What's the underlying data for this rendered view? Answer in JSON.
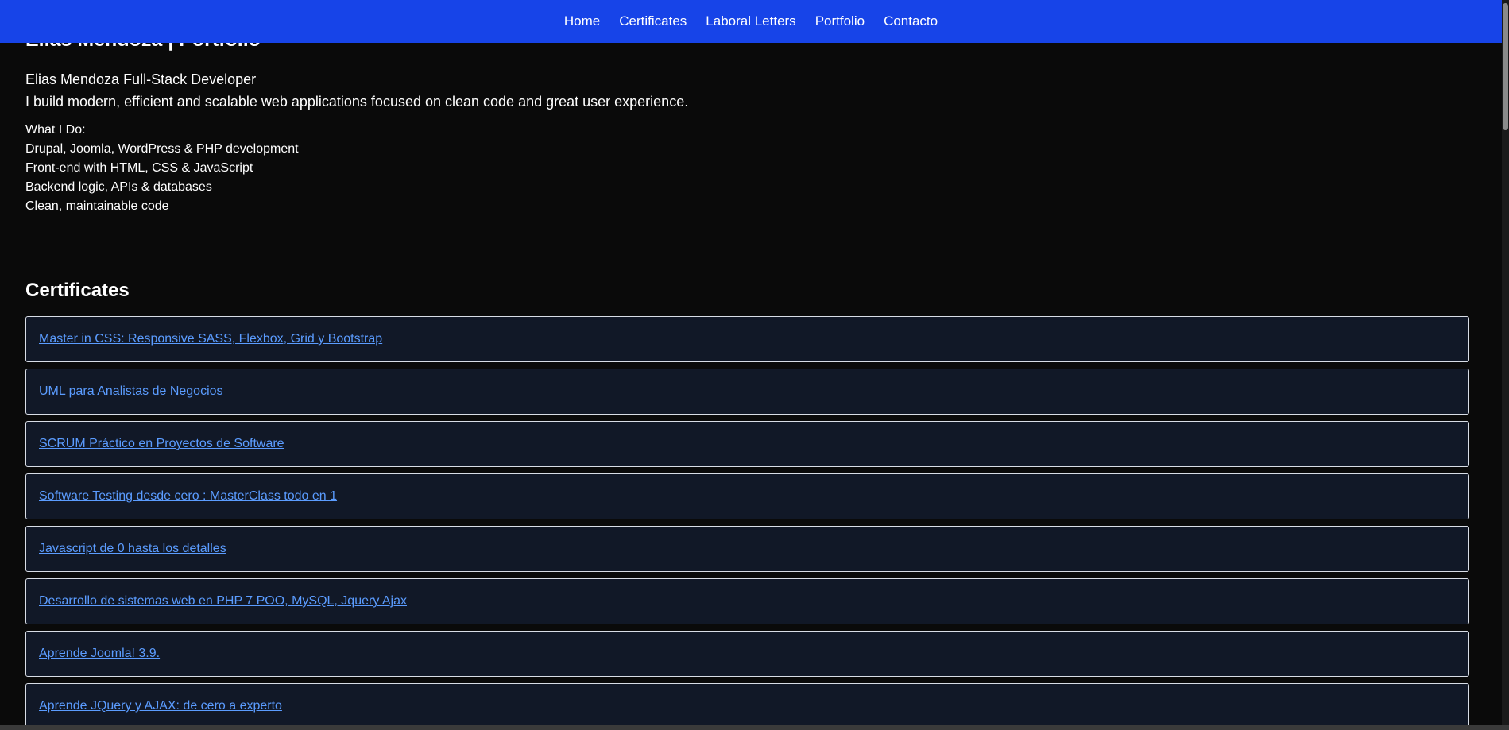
{
  "nav": {
    "items": [
      {
        "label": "Home"
      },
      {
        "label": "Certificates"
      },
      {
        "label": "Laboral Letters"
      },
      {
        "label": "Portfolio"
      },
      {
        "label": "Contacto"
      }
    ]
  },
  "hero": {
    "title": "Elias Mendoza | Portfolio",
    "subtitle": "Elias Mendoza Full-Stack Developer",
    "tagline": "I build modern, efficient and scalable web applications focused on clean code and great user experience.",
    "skills_heading": "What I Do:",
    "skills": [
      "Drupal, Joomla, WordPress & PHP development",
      "Front-end with HTML, CSS & JavaScript",
      "Backend logic, APIs & databases",
      "Clean, maintainable code"
    ]
  },
  "certificates": {
    "title": "Certificates",
    "items": [
      {
        "label": "Master in CSS: Responsive SASS, Flexbox, Grid y Bootstrap"
      },
      {
        "label": "UML para Analistas de Negocios"
      },
      {
        "label": "SCRUM Práctico en Proyectos de Software"
      },
      {
        "label": "Software Testing desde cero : MasterClass todo en 1"
      },
      {
        "label": "Javascript de 0 hasta los detalles"
      },
      {
        "label": "Desarrollo de sistemas web en PHP 7 POO, MySQL, Jquery Ajax"
      },
      {
        "label": "Aprende Joomla! 3.9."
      },
      {
        "label": "Aprende JQuery y AJAX: de cero a experto"
      }
    ]
  },
  "colors": {
    "nav_background": "#1744e8",
    "page_background": "#0a0a0a",
    "card_background": "#111827",
    "link": "#5b9cff"
  }
}
